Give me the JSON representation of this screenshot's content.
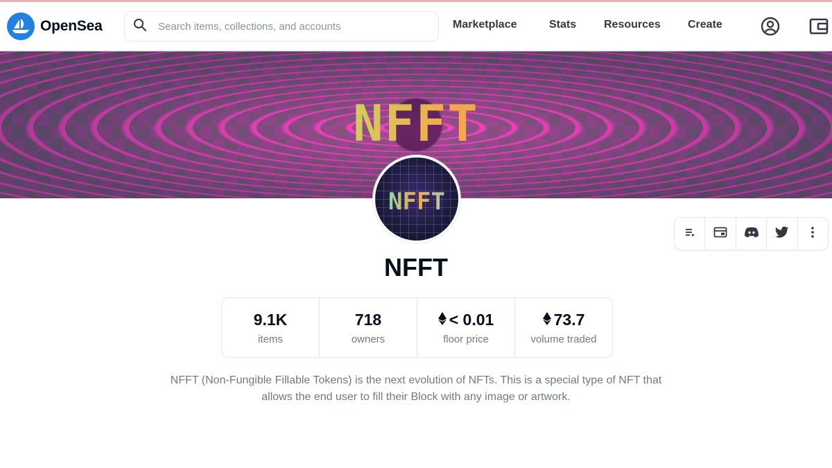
{
  "navbar": {
    "logo_text": "OpenSea",
    "search_placeholder": "Search items, collections, and accounts",
    "links": [
      "Marketplace",
      "Stats",
      "Resources",
      "Create"
    ],
    "icons": [
      "account-icon",
      "wallet-icon"
    ]
  },
  "banner": {
    "title": "NFFT"
  },
  "avatar": {
    "text": "NFFT"
  },
  "social_buttons": [
    "activity-icon",
    "website-icon",
    "discord-icon",
    "twitter-icon",
    "more-icon"
  ],
  "collection": {
    "name": "NFFT",
    "stats": [
      {
        "value": "9.1K",
        "label": "items",
        "eth": false
      },
      {
        "value": "718",
        "label": "owners",
        "eth": false
      },
      {
        "value": "< 0.01",
        "label": "floor price",
        "eth": true
      },
      {
        "value": "73.7",
        "label": "volume traded",
        "eth": true
      }
    ],
    "description": "NFFT (Non-Fungible Fillable Tokens) is the next evolution of NFTs. This is a special type of NFT that allows the end user to fill their Block with any image or artwork."
  },
  "colors": {
    "brand": "#2081e2",
    "text": "#04111d",
    "muted": "#707a83",
    "border": "#e5e8eb"
  }
}
